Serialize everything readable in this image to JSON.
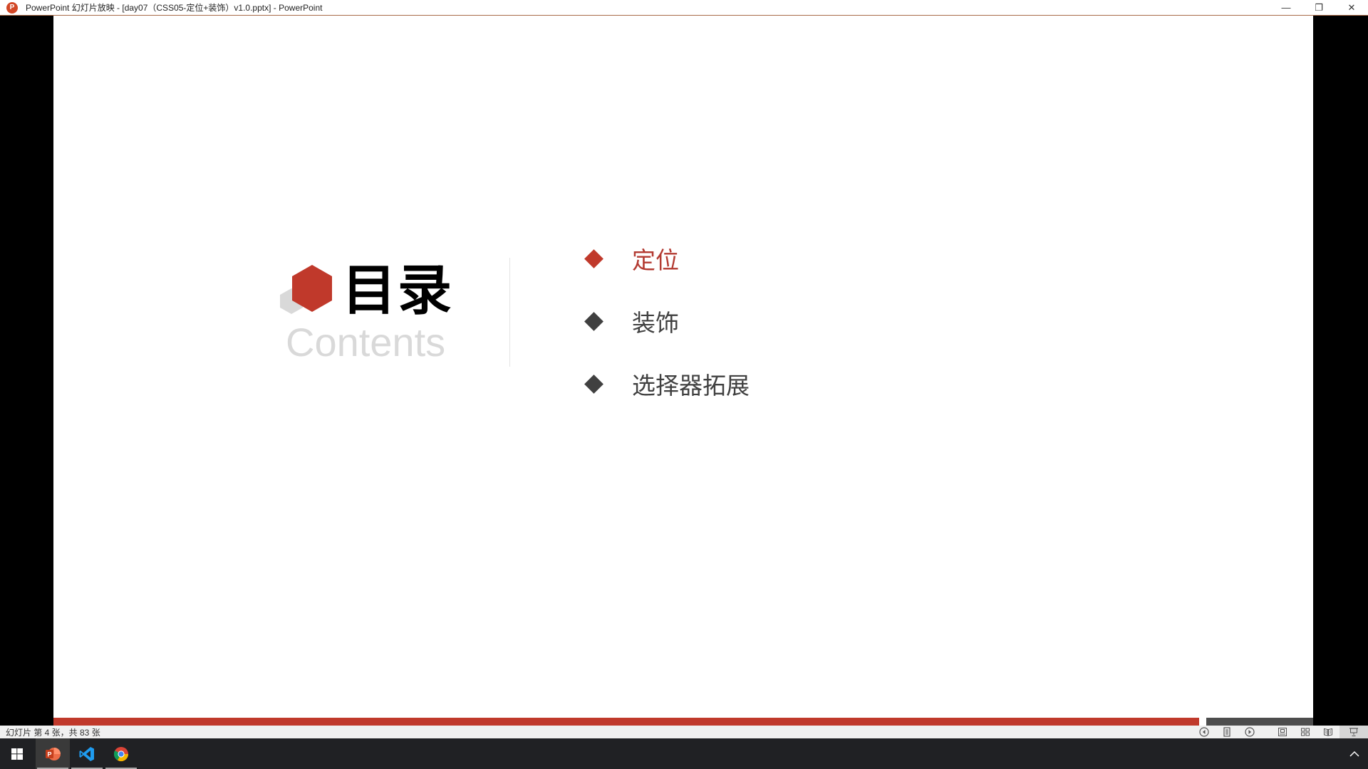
{
  "window": {
    "title": "PowerPoint 幻灯片放映 - [day07（CSS05-定位+装饰）v1.0.pptx] - PowerPoint",
    "app_icon_letter": "P",
    "controls": {
      "minimize": "—",
      "restore": "❐",
      "close": "✕"
    }
  },
  "slide": {
    "title": "目录",
    "subtitle": "Contents",
    "items": [
      {
        "label": "定位",
        "active": true
      },
      {
        "label": "装饰",
        "active": false
      },
      {
        "label": "选择器拓展",
        "active": false
      }
    ],
    "progress": {
      "current": 4,
      "total": 83,
      "red_fraction": 0.9095
    }
  },
  "colors": {
    "accent_red": "#c0392b",
    "text_dark": "#404040",
    "subtitle_gray": "#d9d9d9",
    "hex_gray": "#d9d9d9"
  },
  "statusbar": {
    "slide_info": "幻灯片 第 4 张，共 83 张",
    "icons": [
      "previous-icon",
      "notes-icon",
      "next-icon",
      "normal-view-icon",
      "slide-sorter-icon",
      "reading-view-icon",
      "slideshow-icon"
    ]
  },
  "taskbar": {
    "apps": [
      "start",
      "powerpoint",
      "vscode",
      "chrome"
    ],
    "tray": "show-hidden-icons"
  }
}
